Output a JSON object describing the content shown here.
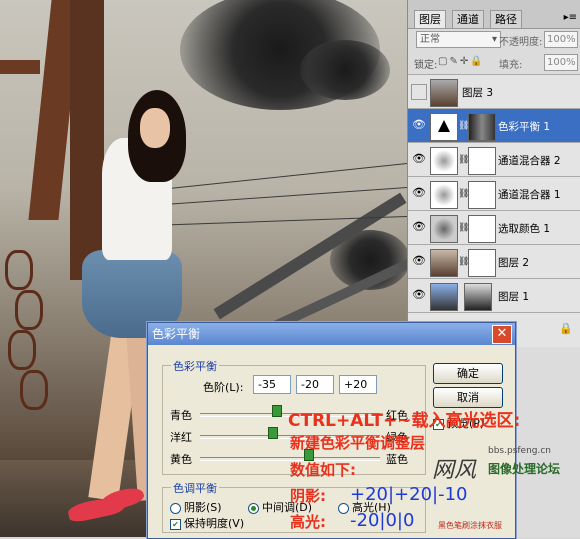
{
  "layers_panel": {
    "tabs": [
      "图层",
      "通道",
      "路径"
    ],
    "blend_mode": "正常",
    "opacity_label": "不透明度:",
    "opacity_value": "100%",
    "lock_label": "锁定:",
    "fill_label": "填充:",
    "fill_value": "100%",
    "layers": [
      {
        "name": "图层 3",
        "visible": false,
        "selected": false
      },
      {
        "name": "色彩平衡 1",
        "visible": true,
        "selected": true
      },
      {
        "name": "通道混合器 2",
        "visible": true,
        "selected": false
      },
      {
        "name": "通道混合器 1",
        "visible": true,
        "selected": false
      },
      {
        "name": "选取颜色 1",
        "visible": true,
        "selected": false
      },
      {
        "name": "图层 2",
        "visible": true,
        "selected": false
      },
      {
        "name": "图层 1",
        "visible": true,
        "selected": false
      }
    ]
  },
  "dialog": {
    "title": "色彩平衡",
    "close_symbol": "✕",
    "balance_group_label": "色彩平衡",
    "levels_label": "色阶(L):",
    "levels": [
      "-35",
      "-20",
      "+20"
    ],
    "sliders": [
      {
        "left": "青色",
        "right": "红色",
        "value": 0.42
      },
      {
        "left": "洋红",
        "right": "绿色",
        "value": 0.4
      },
      {
        "left": "黄色",
        "right": "蓝色",
        "value": 0.6
      }
    ],
    "tone_group_label": "色调平衡",
    "tones": [
      {
        "label": "阴影(S)",
        "checked": false
      },
      {
        "label": "中间调(D)",
        "checked": true
      },
      {
        "label": "高光(H)",
        "checked": false
      }
    ],
    "preserve_label": "保持明度(V)",
    "preserve_checked": true,
    "ok_label": "确定",
    "cancel_label": "取消",
    "preview_label": "预览(P)"
  },
  "annotations": {
    "line1": "CTRL+ALT+~载入高光选区:",
    "line2": "新建色彩平衡调整层",
    "line3": "数值如下:",
    "shadow_label": "阴影:",
    "shadow_values": "+20|+20|-10",
    "highlight_label": "高光:",
    "highlight_values": "-20|0|0",
    "note": "黑色笔刷涂抹衣服"
  },
  "watermark": {
    "url": "bbs.psfeng.cn",
    "brand": "图像处理论坛",
    "logo_text": "网风"
  }
}
